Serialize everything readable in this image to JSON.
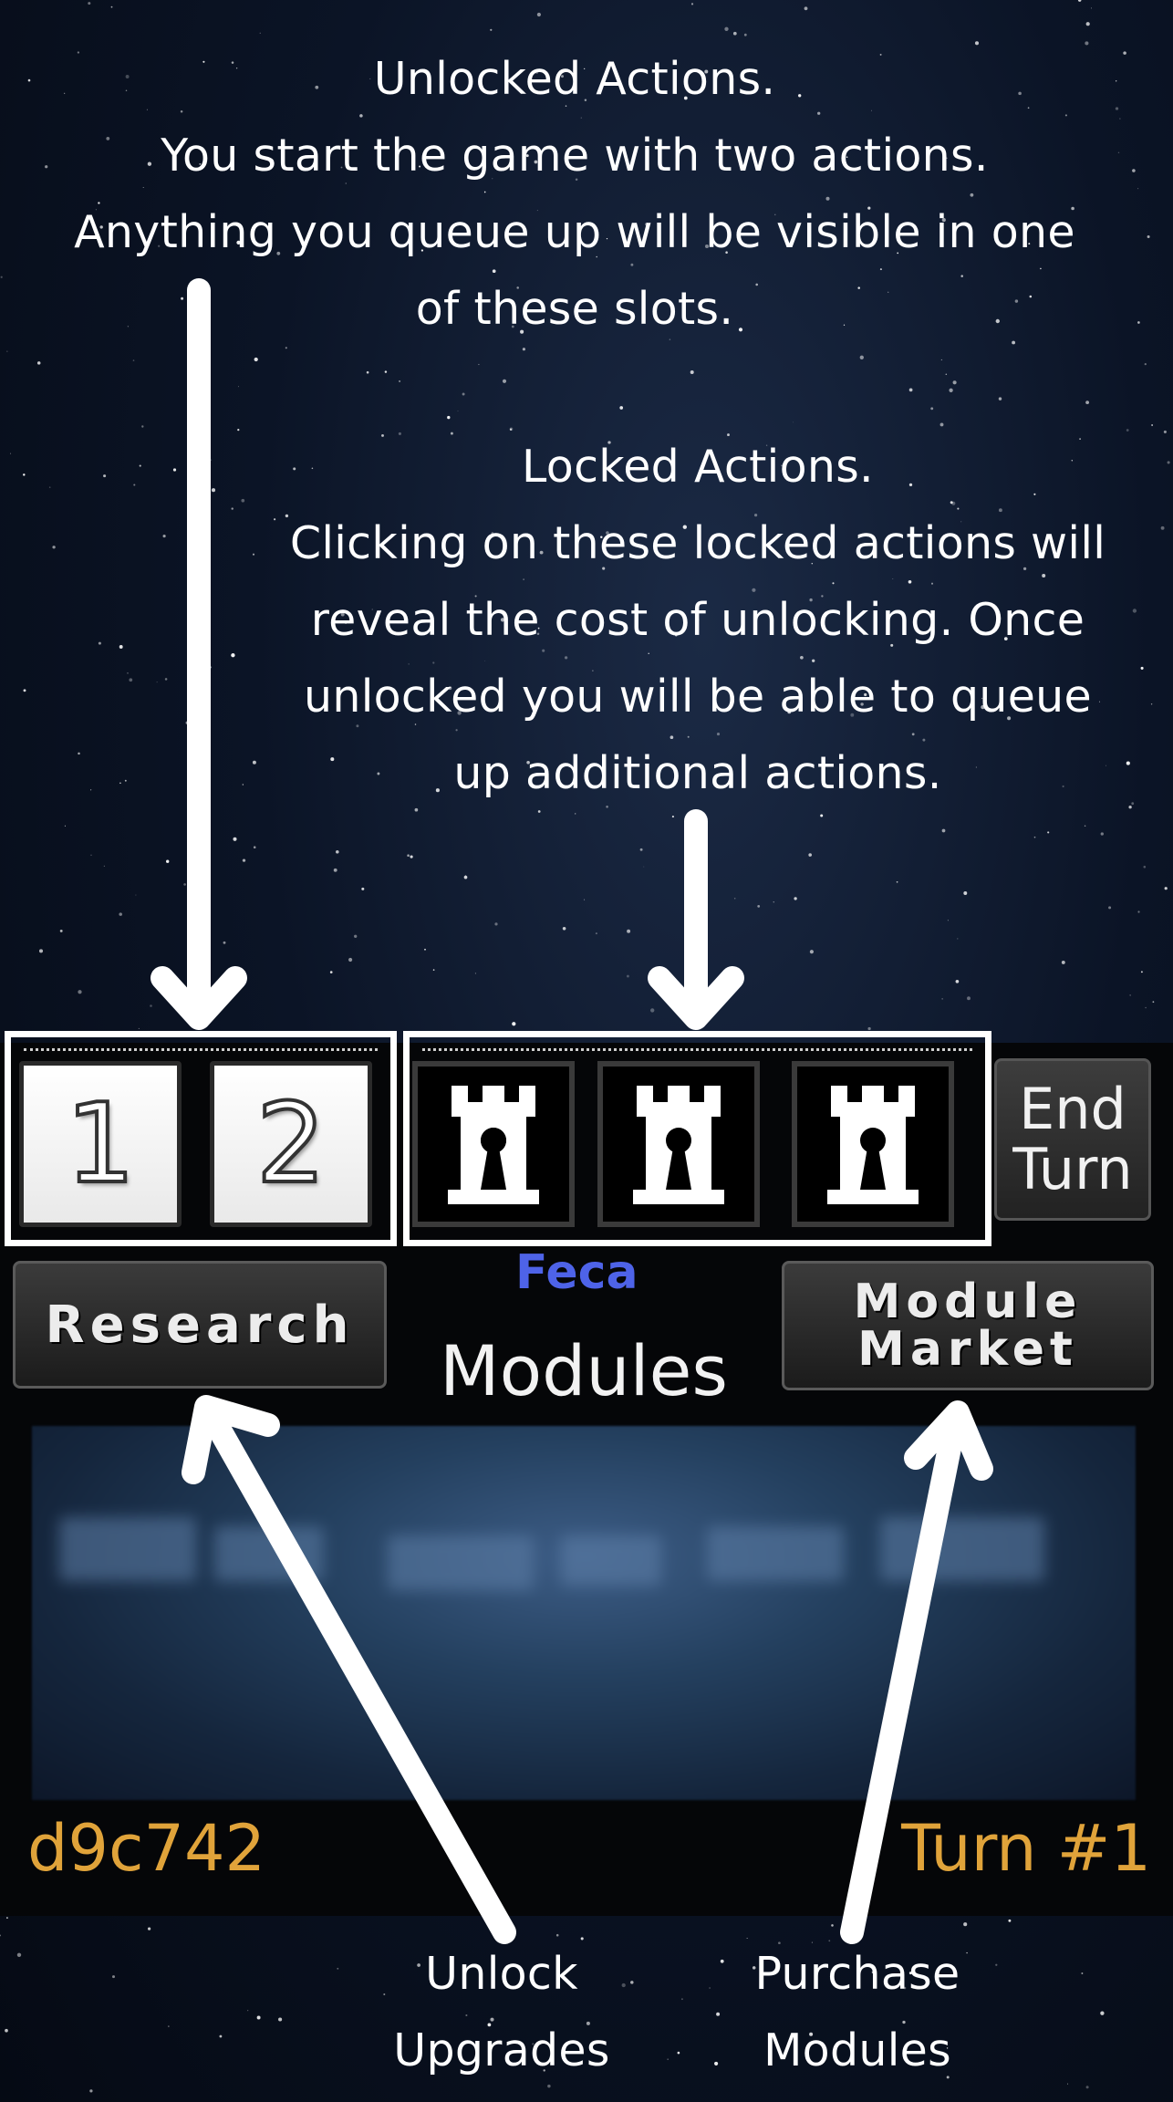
{
  "annotations": {
    "unlocked_actions": [
      "Unlocked Actions.",
      "You start the game with two actions.",
      "Anything you queue up will be visible in one",
      "of these slots."
    ],
    "locked_actions": [
      "Locked Actions.",
      "Clicking on these locked actions will",
      "reveal the cost of unlocking. Once",
      "unlocked you will be able to queue",
      "up additional actions."
    ],
    "unlock_upgrades": [
      "Unlock",
      "Upgrades"
    ],
    "purchase_modules": [
      "Purchase",
      "Modules"
    ]
  },
  "action_slots": {
    "unlocked": [
      "1",
      "2"
    ],
    "locked": [
      {
        "icon": "locked-tower-icon"
      },
      {
        "icon": "locked-tower-icon"
      },
      {
        "icon": "locked-tower-icon"
      }
    ]
  },
  "end_turn_label": [
    "End",
    "Turn"
  ],
  "research_label": "Research",
  "module_market_label": [
    "Module",
    "Market"
  ],
  "player_name": "Feca",
  "modules_title": "Modules",
  "player_id": "d9c742",
  "turn_label": "Turn #1",
  "colors": {
    "player_name": "#4e63e8",
    "status_text": "#e0a33a",
    "arrow": "#ffffff"
  }
}
